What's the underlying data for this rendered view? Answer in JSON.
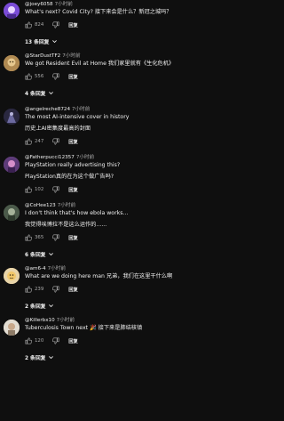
{
  "comments": [
    {
      "user": "@joey6058",
      "time": "7小时前",
      "text": [
        "What's next? Covid City? 接下来会是什么？新冠之城吗？"
      ],
      "likes": "824",
      "reply_label": "回复",
      "replies": "13 条回复",
      "avatar_color": "#7a4bd6"
    },
    {
      "user": "@StarDustTF2",
      "time": "7小时前",
      "text": [
        "We got Resident Evil at Home 我们家里就有《生化危机》"
      ],
      "likes": "556",
      "reply_label": "回复",
      "replies": "4 条回复",
      "avatar_color": "#c9a66b"
    },
    {
      "user": "@angelreche8724",
      "time": "7小时前",
      "text": [
        "The most AI-intensive cover in history",
        "历史上AI密集度最高的封面"
      ],
      "likes": "247",
      "reply_label": "回复",
      "replies": "",
      "avatar_color": "#2e2a44"
    },
    {
      "user": "@Fatherpucci12357",
      "time": "7小时前",
      "text": [
        "PlayStation really advertising this?",
        "PlayStation真的在为这个做广告吗?"
      ],
      "likes": "102",
      "reply_label": "回复",
      "replies": "",
      "avatar_color": "#8a5fa6"
    },
    {
      "user": "@CoHee123",
      "time": "7小时前",
      "text": [
        "I don't think that's how ebola works...",
        "我觉得埃博拉不是这么运作的......"
      ],
      "likes": "365",
      "reply_label": "回复",
      "replies": "6 条回复",
      "avatar_color": "#5b6b5a"
    },
    {
      "user": "@am6-4",
      "time": "7小时前",
      "text": [
        "What are we doing here man 兄弟，我们在这里干什么啊"
      ],
      "likes": "239",
      "reply_label": "回复",
      "replies": "2 条回复",
      "avatar_color": "#d8b989"
    },
    {
      "user": "@Killerbx10",
      "time": "7小时前",
      "text": [
        "Tuberculosis Town next 🎉 接下来是肺结核镇"
      ],
      "likes": "120",
      "reply_label": "回复",
      "replies": "2 条回复",
      "avatar_color": "#d9d3c8"
    }
  ]
}
